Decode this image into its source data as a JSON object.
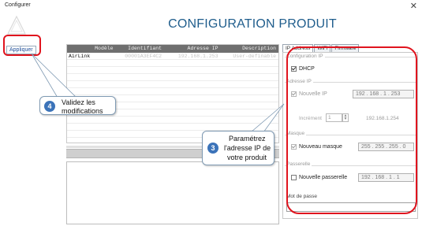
{
  "window": {
    "title": "Configurer",
    "close_glyph": "✕"
  },
  "app": {
    "logo_icon": "triangle-logo-icon"
  },
  "page": {
    "title": "CONFIGURATION PRODUIT"
  },
  "sidebar": {
    "apply_label": "Appliquer"
  },
  "grid": {
    "columns": [
      "Modèle",
      "Identifiant",
      "Adresse IP",
      "Description"
    ],
    "rows": [
      [
        "AirLink",
        "00001A3EF4C2",
        "192.168.1.253",
        "User-definable"
      ]
    ]
  },
  "tabs": [
    {
      "label": "IP Address",
      "active": true
    },
    {
      "label": "WiFi",
      "active": false
    },
    {
      "label": "Firmware",
      "active": false
    }
  ],
  "ip_panel": {
    "section_config": "Configuration IP",
    "dhcp_label": "DHCP",
    "dhcp_checked": true,
    "section_address": "Adresse IP",
    "new_ip_label": "Nouvelle IP",
    "new_ip_checked": true,
    "new_ip_value": "192 . 168 . 1 . 253",
    "increment_label": "Incrément",
    "increment_value": "1",
    "increment_result": "192.168.1.254",
    "section_mask": "Masque",
    "new_mask_label": "Nouveau masque",
    "new_mask_checked": true,
    "new_mask_value": "255 . 255 . 255 . 0",
    "section_gateway": "Passerelle",
    "new_gateway_label": "Nouvelle passerelle",
    "new_gateway_checked": false,
    "new_gateway_value": "192 . 168 . 1 . 1",
    "password_label": "Mot de passe",
    "password_value": ""
  },
  "callouts": {
    "step3": {
      "number": "3",
      "line1": "Paramétrez",
      "line2": "l'adresse IP de",
      "line3": "votre produit"
    },
    "step4": {
      "number": "4",
      "line1": "Validez les",
      "line2": "modifications"
    }
  },
  "colors": {
    "highlight": "#e0141e",
    "title": "#1f5d8c",
    "badge": "#3b73b9"
  }
}
